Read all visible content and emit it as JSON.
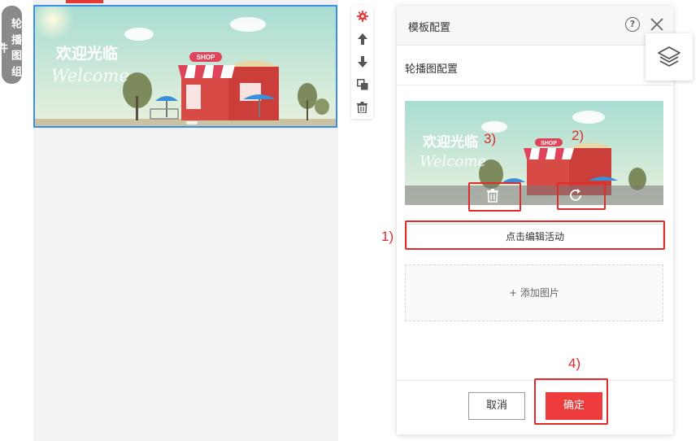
{
  "side_tab": {
    "chars": [
      "轮",
      "播",
      "图",
      "组",
      "件"
    ]
  },
  "banner": {
    "headline": "欢迎光临",
    "script": "Welcome",
    "shop_sign": "SHOP"
  },
  "toolbar": {
    "icons": [
      "gear-icon",
      "arrow-up-icon",
      "arrow-down-icon",
      "copy-icon",
      "trash-icon"
    ],
    "accent": "#e53935"
  },
  "panel": {
    "title": "模板配置",
    "help_glyph": "?",
    "section_title": "轮播图配置",
    "edit_button": "点击编辑活动",
    "add_image": "+ 添加图片",
    "cancel": "取消",
    "confirm": "确定"
  },
  "annotations": {
    "a1": "1)",
    "a2": "2)",
    "a3": "3)",
    "a4": "4)"
  },
  "colors": {
    "selection_border": "#3d8fe8",
    "annotation": "#e12b2b",
    "confirm_bg": "#ee3b3b"
  }
}
